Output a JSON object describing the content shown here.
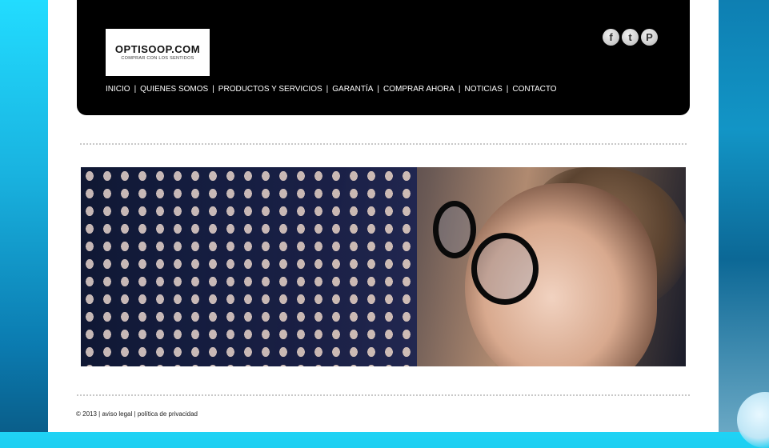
{
  "logo": {
    "name": "OPTISOOP.COM",
    "tagline": "COMPRAR CON LOS SENTIDOS"
  },
  "social": [
    {
      "icon": "facebook-icon",
      "glyph": "f"
    },
    {
      "icon": "twitter-icon",
      "glyph": "t"
    },
    {
      "icon": "pinterest-icon",
      "glyph": "P"
    }
  ],
  "nav": {
    "items": [
      "INICIO",
      "QUIENES SOMOS",
      "PRODUCTOS Y SERVICIOS",
      "GARANTÍA",
      "COMPRAR AHORA",
      "NOTICIAS",
      "CONTACTO"
    ],
    "separator": "|"
  },
  "footer": {
    "copyright": "© 2013",
    "sep1": "|",
    "legal": "aviso legal",
    "sep2": "|",
    "privacy": "política de privacidad"
  },
  "colors": {
    "header_bg": "#000000",
    "page_bg": "#ffffff",
    "outer_bg": "#16a9d3"
  }
}
